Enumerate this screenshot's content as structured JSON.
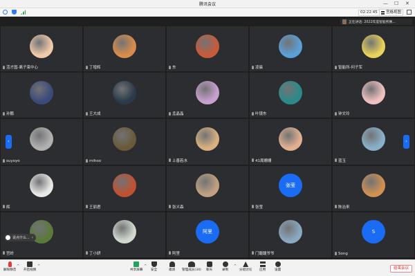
{
  "window": {
    "title": "腾讯会议",
    "min": "—",
    "max": "☐",
    "close": "✕"
  },
  "topbar": {
    "timer": "02:22:45",
    "view_label": "宫格视图"
  },
  "speaking": {
    "text": "正在讲话: 2022年度智能所赛..."
  },
  "participants": [
    {
      "name": "活才国-离子束中心",
      "avatar": "cartoon-girl",
      "color": "#f0c9a8"
    },
    {
      "name": "丁增辉",
      "avatar": "sunset-photo",
      "color": "#d98c4a"
    },
    {
      "name": "东",
      "avatar": "bear-cartoon",
      "color": "#c85a3a"
    },
    {
      "name": "凌晨",
      "avatar": "sky-photo",
      "color": "#5aa0d8"
    },
    {
      "name": "智能所-何子军",
      "avatar": "cartoon-character",
      "color": "#e8d25a"
    },
    {
      "name": "孙鹏",
      "avatar": "galaxy-photo",
      "color": "#3a4a7a"
    },
    {
      "name": "王大成",
      "avatar": "person-photo",
      "color": "#2a3a4a"
    },
    {
      "name": "孟晶晶",
      "avatar": "anime-girl",
      "color": "#c8a0d0"
    },
    {
      "name": "叶镜东",
      "avatar": "dragon-cartoon",
      "color": "#2a8a8a"
    },
    {
      "name": "钟文玲",
      "avatar": "girl-photo",
      "color": "#f0c0c0"
    },
    {
      "name": "suyoyo",
      "avatar": "dog-photo",
      "color": "#b0b0b0"
    },
    {
      "name": "mihoo",
      "avatar": "cat-photo",
      "color": "#6a5a3a"
    },
    {
      "name": "上善若水",
      "avatar": "kid-photo",
      "color": "#d8b080"
    },
    {
      "name": "41周姗姗",
      "avatar": "woman-photo",
      "color": "#e0b090"
    },
    {
      "name": "蓝玉",
      "avatar": "cat-cartoon",
      "color": "#8ab0c8"
    },
    {
      "name": "辉",
      "avatar": "cartoon-scene",
      "color": "#e8e8e8"
    },
    {
      "name": "王丽君",
      "avatar": "tree-photo",
      "color": "#c05030"
    },
    {
      "name": "张义森",
      "avatar": "drink-photo",
      "color": "#c0a080"
    },
    {
      "name": "张莹",
      "avatar": "text-avatar",
      "initial": "张莹",
      "color": "#1a6cf5"
    },
    {
      "name": "陈治来",
      "avatar": "tower-photo",
      "color": "#d09050"
    },
    {
      "name": "宫岭",
      "avatar": "painting-photo",
      "color": "#5a7a3a"
    },
    {
      "name": "丁小妍",
      "avatar": "plate-photo",
      "color": "#d0d8d0"
    },
    {
      "name": "阿里",
      "avatar": "text-avatar",
      "initial": "阿里",
      "color": "#1a6cf5"
    },
    {
      "name": "门馥馥爷爷",
      "avatar": "sky-photo-2",
      "color": "#8aa8c0"
    },
    {
      "name": "Song",
      "avatar": "text-avatar",
      "initial": "S",
      "color": "#1a6cf5"
    }
  ],
  "chat_popup": {
    "text": "说点什么..."
  },
  "toolbar": {
    "mute": "解除静音",
    "video": "开启视频",
    "share": "共享屏幕",
    "security": "安全",
    "invite": "邀请",
    "members": "管理成员(34)",
    "chat": "聊天",
    "record": "录制",
    "rooms": "分组讨论",
    "apps": "应用",
    "settings": "设置",
    "end": "结束会议"
  }
}
